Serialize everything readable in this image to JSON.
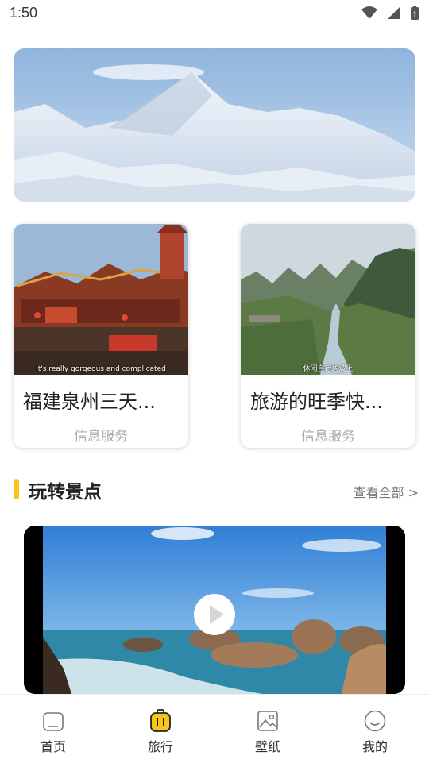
{
  "status_bar": {
    "time": "1:50",
    "icons": [
      "wifi-icon",
      "signal-icon",
      "battery-icon"
    ]
  },
  "banner": {
    "image": "snow-mountain-photo"
  },
  "cards": [
    {
      "title": "福建泉州三天...",
      "subtitle": "信息服务",
      "caption": "It's really gorgeous and complicated",
      "image": "temple-photo"
    },
    {
      "title": "旅游的旺季快...",
      "subtitle": "信息服务",
      "caption": "休闲自行碧波上",
      "image": "river-valley-photo"
    }
  ],
  "section": {
    "title": "玩转景点",
    "view_all": "查看全部 >"
  },
  "video": {
    "image": "seaside-rocks-photo",
    "play_icon": "play-icon"
  },
  "tabs": [
    {
      "label": "首页",
      "icon": "home-icon"
    },
    {
      "label": "旅行",
      "icon": "luggage-icon",
      "active": true
    },
    {
      "label": "壁纸",
      "icon": "picture-icon"
    },
    {
      "label": "我的",
      "icon": "smile-icon"
    }
  ],
  "colors": {
    "accent": "#f5c518",
    "subtext": "#aaaaaa",
    "text": "#222222"
  }
}
